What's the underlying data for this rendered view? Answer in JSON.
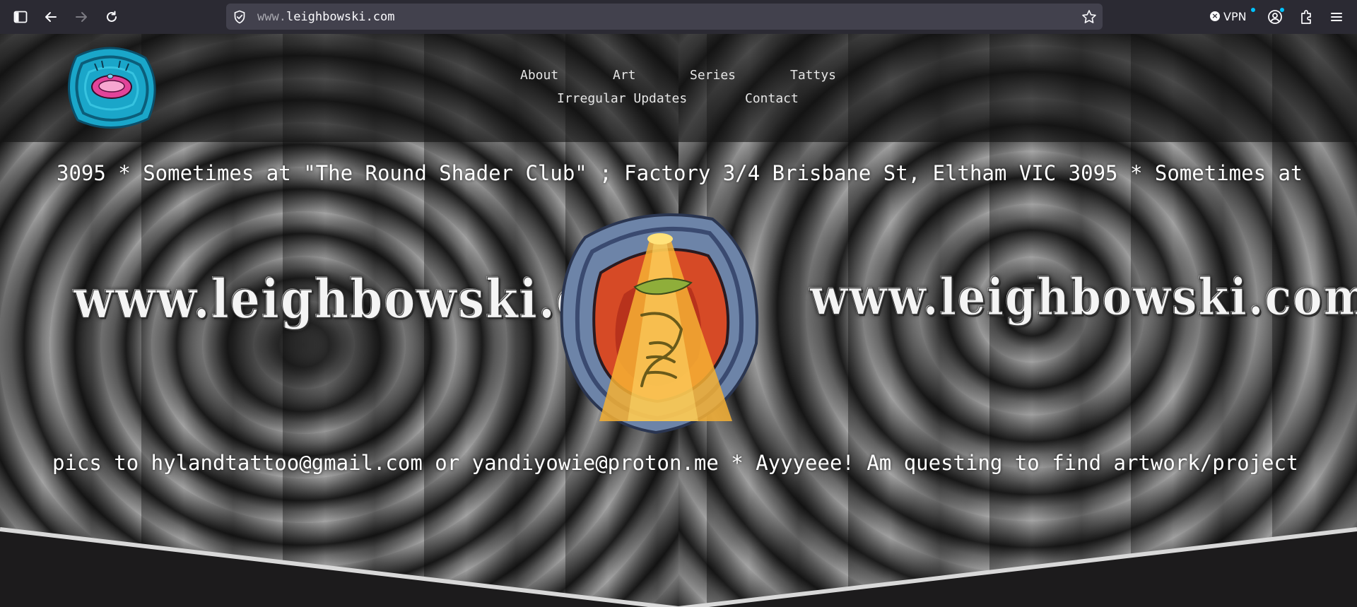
{
  "browser": {
    "url_prefix": "www.",
    "url_domain": "leighbowski.com",
    "vpn_label": "VPN",
    "icons": [
      "sidebar-icon",
      "back-icon",
      "forward-icon",
      "reload-icon",
      "shield-icon",
      "bookmark-star-icon",
      "vpn-status-icon",
      "account-icon",
      "extensions-icon",
      "menu-icon"
    ]
  },
  "nav": {
    "items": [
      "About",
      "Art",
      "Series",
      "Tattys",
      "Irregular Updates",
      "Contact"
    ]
  },
  "marquee": {
    "top_text": "3095 * Sometimes at \"The Round Shader Club\" ; Factory 3/4 Brisbane St, Eltham VIC 3095 * Sometimes at",
    "bottom_text": "pics to hylandtattoo@gmail.com or yandiyowie@proton.me * Ayyyeee! Am questing to find artwork/projects"
  },
  "banners": {
    "left": "www.leighbowski.com",
    "right": "www.leighbowski.com.au"
  },
  "colors": {
    "chrome_bg": "#2b2a33",
    "urlbar_bg": "#42414d",
    "page_bottom": "#1c1b1c",
    "accent_dot": "#00c3ff"
  }
}
